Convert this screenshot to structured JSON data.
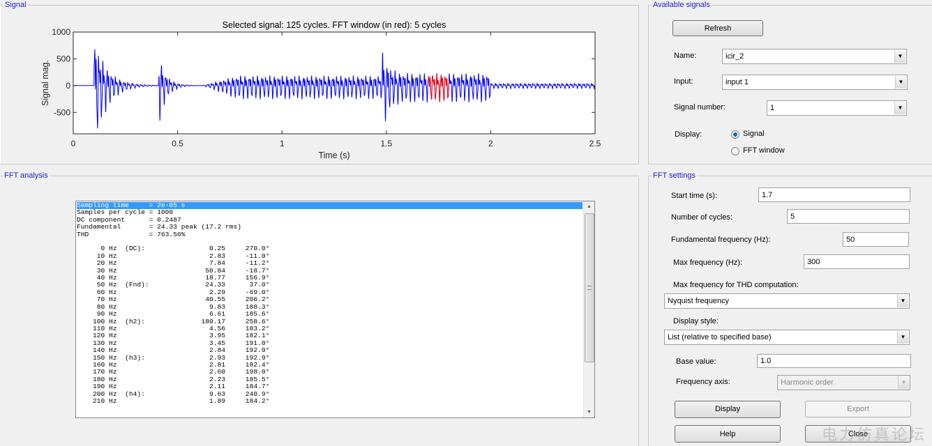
{
  "panels": {
    "signal": "Signal",
    "available": "Available signals",
    "fft_analysis": "FFT analysis",
    "fft_settings": "FFT settings"
  },
  "chart_data": {
    "type": "line",
    "title": "Selected signal: 125 cycles. FFT window (in red): 5 cycles",
    "xlabel": "Time (s)",
    "ylabel": "Signal mag.",
    "xlim": [
      0,
      2.5
    ],
    "ylim": [
      -900,
      1000
    ],
    "xticks": [
      "0",
      "0.5",
      "1",
      "1.5",
      "2",
      "2.5"
    ],
    "xtick_values": [
      0,
      0.5,
      1,
      1.5,
      2,
      2.5
    ],
    "yticks": [
      "1000",
      "500",
      "0",
      "-500"
    ],
    "ytick_values": [
      1000,
      500,
      0,
      -500
    ],
    "grid": false,
    "series_color": "#0000ff",
    "fft_window": {
      "start": 1.7,
      "end": 1.8,
      "color": "#ff0000"
    }
  },
  "available": {
    "refresh": "Refresh",
    "name_label": "Name:",
    "name_value": "icir_2",
    "input_label": "Input:",
    "input_value": "input 1",
    "signal_number_label": "Signal number:",
    "signal_number_value": "1",
    "display_label": "Display:",
    "radio_signal": "Signal",
    "radio_fft": "FFT window",
    "selected": "Signal"
  },
  "fft_list": {
    "header": [
      "Sampling time     = 2e-05 s",
      "Samples per cycle = 1000",
      "DC component      = 0.2487",
      "Fundamental       = 24.33 peak (17.2 rms)",
      "THD               = 763.56%"
    ],
    "rows": [
      {
        "f": "0 Hz",
        "tag": "(DC):",
        "mag": "0.25",
        "ph": "270.0°"
      },
      {
        "f": "10 Hz",
        "tag": "",
        "mag": "2.83",
        "ph": "-11.0°"
      },
      {
        "f": "20 Hz",
        "tag": "",
        "mag": "7.84",
        "ph": "-11.2°"
      },
      {
        "f": "30 Hz",
        "tag": "",
        "mag": "50.84",
        "ph": "-18.7°"
      },
      {
        "f": "40 Hz",
        "tag": "",
        "mag": "18.77",
        "ph": "156.9°"
      },
      {
        "f": "50 Hz",
        "tag": "(Fnd):",
        "mag": "24.33",
        "ph": "37.0°"
      },
      {
        "f": "60 Hz",
        "tag": "",
        "mag": "2.29",
        "ph": "-69.0°"
      },
      {
        "f": "70 Hz",
        "tag": "",
        "mag": "40.55",
        "ph": "206.2°"
      },
      {
        "f": "80 Hz",
        "tag": "",
        "mag": "9.83",
        "ph": "188.3°"
      },
      {
        "f": "90 Hz",
        "tag": "",
        "mag": "6.61",
        "ph": "185.6°"
      },
      {
        "f": "100 Hz",
        "tag": "(h2):",
        "mag": "180.17",
        "ph": "258.6°"
      },
      {
        "f": "110 Hz",
        "tag": "",
        "mag": "4.56",
        "ph": "183.2°"
      },
      {
        "f": "120 Hz",
        "tag": "",
        "mag": "3.95",
        "ph": "182.1°"
      },
      {
        "f": "130 Hz",
        "tag": "",
        "mag": "3.45",
        "ph": "191.0°"
      },
      {
        "f": "140 Hz",
        "tag": "",
        "mag": "2.84",
        "ph": "192.0°"
      },
      {
        "f": "150 Hz",
        "tag": "(h3):",
        "mag": "2.93",
        "ph": "192.9°"
      },
      {
        "f": "160 Hz",
        "tag": "",
        "mag": "2.81",
        "ph": "182.4°"
      },
      {
        "f": "170 Hz",
        "tag": "",
        "mag": "2.60",
        "ph": "198.0°"
      },
      {
        "f": "180 Hz",
        "tag": "",
        "mag": "2.23",
        "ph": "185.5°"
      },
      {
        "f": "190 Hz",
        "tag": "",
        "mag": "2.11",
        "ph": "184.7°"
      },
      {
        "f": "200 Hz",
        "tag": "(h4):",
        "mag": "9.63",
        "ph": "240.9°"
      },
      {
        "f": "210 Hz",
        "tag": "",
        "mag": "1.89",
        "ph": "184.2°"
      }
    ]
  },
  "settings": {
    "start_time_label": "Start time (s):",
    "start_time": "1.7",
    "cycles_label": "Number of cycles:",
    "cycles": "5",
    "fund_label": "Fundamental frequency (Hz):",
    "fund": "50",
    "maxf_label": "Max frequency (Hz):",
    "maxf": "300",
    "thd_label": "Max frequency for THD computation:",
    "thd_value": "Nyquist frequency",
    "style_label": "Display style:",
    "style_value": "List (relative to specified base)",
    "base_label": "Base value:",
    "base": "1.0",
    "axis_label": "Frequency axis:",
    "axis_value": "Harmonic order",
    "display": "Display",
    "export": "Export",
    "help": "Help",
    "close": "Close"
  },
  "watermark": "电力仿真论坛"
}
